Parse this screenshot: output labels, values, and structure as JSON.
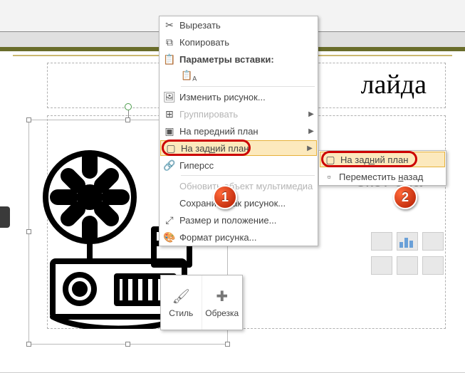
{
  "slide": {
    "title_fragment": "лайда",
    "body_placeholder_fragment": "екст сла"
  },
  "context_menu": {
    "cut": "Вырезать",
    "copy": "Копировать",
    "paste_options_header": "Параметры вставки:",
    "change_picture": "Изменить рисунок...",
    "group": "Группировать",
    "bring_to_front": "На передний план",
    "send_to_back": "На задний план",
    "hyperlink": "Гиперсс",
    "update_media": "Обновить объект мультимедиа",
    "save_as_picture": "Сохранить как рисунок...",
    "size_and_position": "Размер и положение...",
    "format_picture": "Формат рисунка..."
  },
  "submenu": {
    "send_to_back": "На задний план",
    "send_backward": "Переместить назад"
  },
  "mini_toolbar": {
    "style": "Стиль",
    "crop": "Обрезка"
  },
  "badges": {
    "one": "1",
    "two": "2"
  }
}
